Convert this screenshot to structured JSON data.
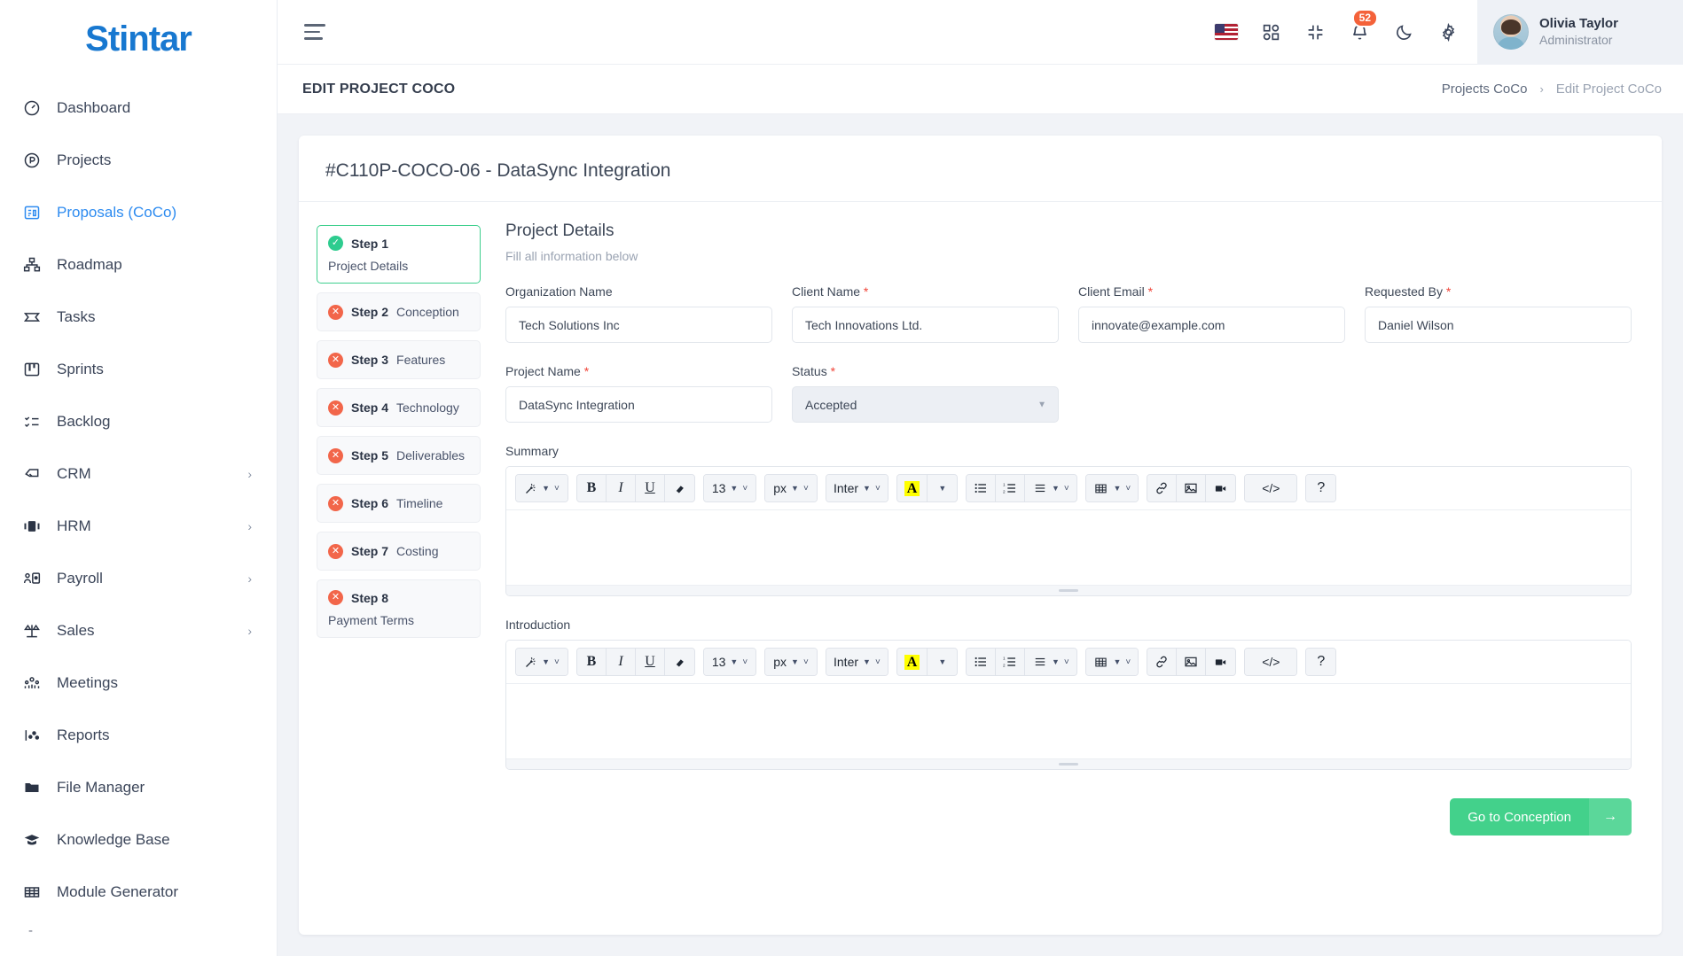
{
  "brand": {
    "name": "Stintar"
  },
  "sidebar": {
    "items": [
      {
        "label": "Dashboard",
        "icon": "gauge-icon",
        "has_submenu": false,
        "active": false
      },
      {
        "label": "Projects",
        "icon": "circle-p-icon",
        "has_submenu": false,
        "active": false
      },
      {
        "label": "Proposals (CoCo)",
        "icon": "proposal-icon",
        "has_submenu": false,
        "active": true
      },
      {
        "label": "Roadmap",
        "icon": "hierarchy-icon",
        "has_submenu": false,
        "active": false
      },
      {
        "label": "Tasks",
        "icon": "ticket-icon",
        "has_submenu": false,
        "active": false
      },
      {
        "label": "Sprints",
        "icon": "board-icon",
        "has_submenu": false,
        "active": false
      },
      {
        "label": "Backlog",
        "icon": "checklist-icon",
        "has_submenu": false,
        "active": false
      },
      {
        "label": "CRM",
        "icon": "handshake-icon",
        "has_submenu": true,
        "active": false
      },
      {
        "label": "HRM",
        "icon": "people-card-icon",
        "has_submenu": true,
        "active": false
      },
      {
        "label": "Payroll",
        "icon": "user-money-icon",
        "has_submenu": true,
        "active": false
      },
      {
        "label": "Sales",
        "icon": "scale-icon",
        "has_submenu": true,
        "active": false
      },
      {
        "label": "Meetings",
        "icon": "group-icon",
        "has_submenu": false,
        "active": false
      },
      {
        "label": "Reports",
        "icon": "chart-dots-icon",
        "has_submenu": false,
        "active": false
      },
      {
        "label": "File Manager",
        "icon": "folder-icon",
        "has_submenu": false,
        "active": false
      },
      {
        "label": "Knowledge Base",
        "icon": "graduation-cap-icon",
        "has_submenu": false,
        "active": false
      },
      {
        "label": "Module Generator",
        "icon": "grid-table-icon",
        "has_submenu": false,
        "active": false
      }
    ]
  },
  "topbar": {
    "menu_toggle": "hamburger-icon",
    "language_flag": "us-flag-icon",
    "apps": "apps-grid-icon",
    "fullscreen": "collapse-screen-icon",
    "notifications_icon": "bell-icon",
    "notifications_count": "52",
    "dark_mode": "moon-icon",
    "settings": "gear-icon",
    "user": {
      "name": "Olivia Taylor",
      "role": "Administrator"
    }
  },
  "pagehead": {
    "title": "EDIT PROJECT COCO",
    "breadcrumb": {
      "parent": "Projects CoCo",
      "separator": "›",
      "current": "Edit Project CoCo"
    }
  },
  "card": {
    "title": "#C110P-COCO-06 - DataSync Integration"
  },
  "steps": [
    {
      "num": "Step 1",
      "label": "Project Details",
      "state": "ok",
      "current": true
    },
    {
      "num": "Step 2",
      "label": "Conception",
      "state": "err",
      "current": false
    },
    {
      "num": "Step 3",
      "label": "Features",
      "state": "err",
      "current": false
    },
    {
      "num": "Step 4",
      "label": "Technology",
      "state": "err",
      "current": false
    },
    {
      "num": "Step 5",
      "label": "Deliverables",
      "state": "err",
      "current": false
    },
    {
      "num": "Step 6",
      "label": "Timeline",
      "state": "err",
      "current": false
    },
    {
      "num": "Step 7",
      "label": "Costing",
      "state": "err",
      "current": false
    },
    {
      "num": "Step 8",
      "label": "Payment Terms",
      "state": "err",
      "current": false
    }
  ],
  "form": {
    "title": "Project Details",
    "subtitle": "Fill all information below",
    "fields": {
      "organization_name": {
        "label": "Organization Name",
        "required": false,
        "value": "Tech Solutions Inc"
      },
      "client_name": {
        "label": "Client Name",
        "required": true,
        "value": "Tech Innovations Ltd."
      },
      "client_email": {
        "label": "Client Email",
        "required": true,
        "value": "innovate@example.com"
      },
      "requested_by": {
        "label": "Requested By",
        "required": true,
        "value": "Daniel Wilson"
      },
      "project_name": {
        "label": "Project Name",
        "required": true,
        "value": "DataSync Integration"
      },
      "status": {
        "label": "Status",
        "required": true,
        "value": "Accepted"
      }
    },
    "summary": {
      "label": "Summary",
      "value": ""
    },
    "introduction": {
      "label": "Introduction",
      "value": ""
    },
    "required_marker": "*",
    "next_button": {
      "label": "Go to Conception",
      "icon": "arrow-right-icon"
    }
  },
  "editor_toolbar": {
    "font_size": "13",
    "unit": "px",
    "font_family": "Inter",
    "buttons": [
      "magic-wand-icon",
      "bold",
      "italic",
      "underline",
      "eraser-icon",
      "font-size-select",
      "unit-select",
      "font-family-select",
      "text-highlight-icon",
      "bullet-list-icon",
      "numbered-list-icon",
      "align-icon",
      "table-icon",
      "link-icon",
      "image-icon",
      "video-icon",
      "code-icon",
      "help-icon"
    ],
    "bold_label": "B",
    "italic_label": "I",
    "underline_label": "U",
    "highlight_label": "A",
    "code_label": "</>",
    "help_label": "?"
  },
  "colors": {
    "accent_blue": "#2d8bf0",
    "success_green": "#2ecc8f",
    "error_red": "#f2664a",
    "button_green": "#43d18b",
    "badge_orange": "#f4623a"
  }
}
